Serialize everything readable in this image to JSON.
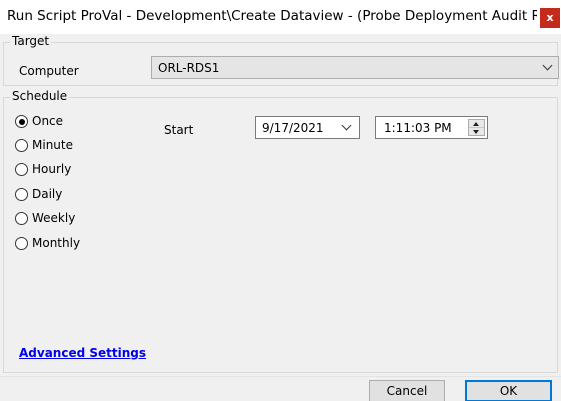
{
  "window": {
    "title": "Run Script ProVal - Development\\Create Dataview - (Probe Deployment Audit Re-De...",
    "close_label": "x"
  },
  "target": {
    "group_label": "Target",
    "computer_label": "Computer",
    "computer_value": "ORL-RDS1"
  },
  "schedule": {
    "group_label": "Schedule",
    "options": [
      {
        "label": "Once",
        "selected": true
      },
      {
        "label": "Minute",
        "selected": false
      },
      {
        "label": "Hourly",
        "selected": false
      },
      {
        "label": "Daily",
        "selected": false
      },
      {
        "label": "Weekly",
        "selected": false
      },
      {
        "label": "Monthly",
        "selected": false
      }
    ],
    "start_label": "Start",
    "start_date": "9/17/2021",
    "start_time": "1:11:03 PM"
  },
  "advanced_settings_link": "Advanced Settings",
  "buttons": {
    "cancel": "Cancel",
    "ok": "OK"
  },
  "colors": {
    "close_button": "#c42b1c",
    "link": "#0000ee",
    "default_button_border": "#0078d7"
  }
}
